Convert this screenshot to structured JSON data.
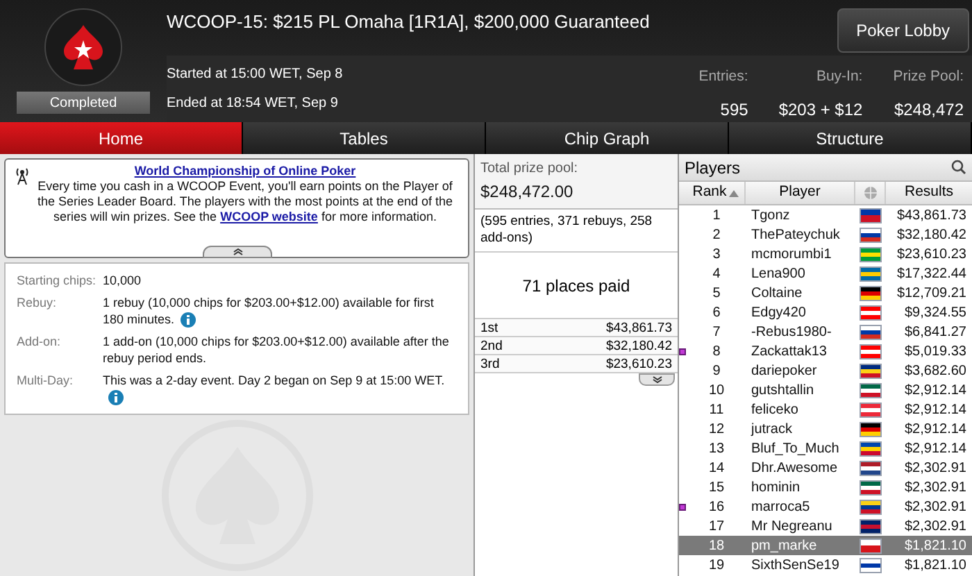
{
  "header": {
    "title": "WCOOP-15: $215 PL Omaha [1R1A], $200,000 Guaranteed",
    "status": "Completed",
    "started": "Started at 15:00 WET, Sep 8",
    "ended": "Ended at 18:54 WET, Sep 9",
    "lobby_button": "Poker Lobby",
    "stats": [
      {
        "label": "Entries:",
        "value": "595"
      },
      {
        "label": "Buy-In:",
        "value": "$203 + $12"
      },
      {
        "label": "Prize Pool:",
        "value": "$248,472"
      }
    ]
  },
  "tabs": [
    {
      "label": "Home",
      "selected": true
    },
    {
      "label": "Tables",
      "selected": false
    },
    {
      "label": "Chip Graph",
      "selected": false
    },
    {
      "label": "Structure",
      "selected": false
    }
  ],
  "notice": {
    "title": "World Championship of Online Poker",
    "text_before": "Every time you cash in a WCOOP Event, you'll earn points on the Player of the Series Leader Board. The players with the most points at the end of the series will win prizes. See the",
    "link": "WCOOP website",
    "text_after": "for more information."
  },
  "details": [
    {
      "label": "Starting chips:",
      "value": "10,000",
      "info": false
    },
    {
      "label": "Rebuy:",
      "value": "1 rebuy (10,000 chips for $203.00+$12.00) available for first 180 minutes.",
      "info": true
    },
    {
      "label": "Add-on:",
      "value": "1 add-on (10,000 chips for $203.00+$12.00) available after the rebuy period ends.",
      "info": false
    },
    {
      "label": "Multi-Day:",
      "value": "This was a 2-day event. Day 2 began on Sep 9 at 15:00 WET.",
      "info": true
    }
  ],
  "prizes": {
    "total_label": "Total prize pool:",
    "total": "$248,472.00",
    "breakdown": "(595 entries, 371 rebuys, 258 add-ons)",
    "places_paid": "71 places paid",
    "places": [
      {
        "place": "1st",
        "amount": "$43,861.73"
      },
      {
        "place": "2nd",
        "amount": "$32,180.42"
      },
      {
        "place": "3rd",
        "amount": "$23,610.23"
      }
    ]
  },
  "players": {
    "title": "Players",
    "columns": [
      "Rank",
      "Player",
      "Results"
    ],
    "rows": [
      {
        "rank": "1",
        "name": "Tgonz",
        "result": "$43,861.73",
        "flag_stripes": [
          {
            "color": "#0038a8"
          },
          {
            "color": "#ce1126"
          }
        ],
        "marked": false,
        "selected": false
      },
      {
        "rank": "2",
        "name": "ThePateychuk",
        "result": "$32,180.42",
        "flag_stripes": [
          {
            "color": "#ffffff"
          },
          {
            "color": "#0039a6"
          },
          {
            "color": "#d52b1e"
          }
        ],
        "marked": false,
        "selected": false
      },
      {
        "rank": "3",
        "name": "mcmorumbi1",
        "result": "$23,610.23",
        "flag_stripes": [
          {
            "color": "#009c3b"
          },
          {
            "color": "#ffdf00"
          },
          {
            "color": "#009c3b"
          }
        ],
        "marked": false,
        "selected": false
      },
      {
        "rank": "4",
        "name": "Lena900",
        "result": "$17,322.44",
        "flag_stripes": [
          {
            "color": "#006aa7"
          },
          {
            "color": "#fecc00"
          },
          {
            "color": "#006aa7"
          }
        ],
        "marked": false,
        "selected": false
      },
      {
        "rank": "5",
        "name": "Coltaine",
        "result": "$12,709.21",
        "flag_stripes": [
          {
            "color": "#000000"
          },
          {
            "color": "#dd0000"
          },
          {
            "color": "#ffce00"
          }
        ],
        "marked": false,
        "selected": false
      },
      {
        "rank": "6",
        "name": "Edgy420",
        "result": "$9,324.55",
        "flag_stripes": [
          {
            "color": "#ff0000"
          },
          {
            "color": "#ffffff"
          },
          {
            "color": "#ff0000"
          }
        ],
        "marked": false,
        "selected": false
      },
      {
        "rank": "7",
        "name": "-Rebus1980-",
        "result": "$6,841.27",
        "flag_stripes": [
          {
            "color": "#ffffff"
          },
          {
            "color": "#0039a6"
          },
          {
            "color": "#d52b1e"
          }
        ],
        "marked": false,
        "selected": false
      },
      {
        "rank": "8",
        "name": "Zackattak13",
        "result": "$5,019.33",
        "flag_stripes": [
          {
            "color": "#ff0000"
          },
          {
            "color": "#ffffff"
          },
          {
            "color": "#ff0000"
          }
        ],
        "marked": true,
        "selected": false
      },
      {
        "rank": "9",
        "name": "dariepoker",
        "result": "$3,682.60",
        "flag_stripes": [
          {
            "color": "#002b7f"
          },
          {
            "color": "#fcd116"
          },
          {
            "color": "#ce1126"
          }
        ],
        "marked": false,
        "selected": false
      },
      {
        "rank": "10",
        "name": "gutshtallin",
        "result": "$2,912.14",
        "flag_stripes": [
          {
            "color": "#006847"
          },
          {
            "color": "#ffffff"
          },
          {
            "color": "#ce1126"
          }
        ],
        "marked": false,
        "selected": false
      },
      {
        "rank": "11",
        "name": "feliceko",
        "result": "$2,912.14",
        "flag_stripes": [
          {
            "color": "#ed2939"
          },
          {
            "color": "#ffffff"
          },
          {
            "color": "#ed2939"
          }
        ],
        "marked": false,
        "selected": false
      },
      {
        "rank": "12",
        "name": "jutrack",
        "result": "$2,912.14",
        "flag_stripes": [
          {
            "color": "#000000"
          },
          {
            "color": "#dd0000"
          },
          {
            "color": "#ffce00"
          }
        ],
        "marked": false,
        "selected": false
      },
      {
        "rank": "13",
        "name": "Bluf_To_Much",
        "result": "$2,912.14",
        "flag_stripes": [
          {
            "color": "#0046ae"
          },
          {
            "color": "#ffd200"
          },
          {
            "color": "#cc092f"
          }
        ],
        "marked": false,
        "selected": false
      },
      {
        "rank": "14",
        "name": "Dhr.Awesome",
        "result": "$2,302.91",
        "flag_stripes": [
          {
            "color": "#ae1c28"
          },
          {
            "color": "#ffffff"
          },
          {
            "color": "#21468b"
          }
        ],
        "marked": false,
        "selected": false
      },
      {
        "rank": "15",
        "name": "hominin",
        "result": "$2,302.91",
        "flag_stripes": [
          {
            "color": "#006847"
          },
          {
            "color": "#ffffff"
          },
          {
            "color": "#ce1126"
          }
        ],
        "marked": false,
        "selected": false
      },
      {
        "rank": "16",
        "name": "marroca5",
        "result": "$2,302.91",
        "flag_stripes": [
          {
            "color": "#fcd116"
          },
          {
            "color": "#003893"
          },
          {
            "color": "#ce1126"
          }
        ],
        "marked": true,
        "selected": false
      },
      {
        "rank": "17",
        "name": "Mr Negreanu",
        "result": "$2,302.91",
        "flag_stripes": [
          {
            "color": "#012169"
          },
          {
            "color": "#c8102e"
          },
          {
            "color": "#012169"
          }
        ],
        "marked": false,
        "selected": false
      },
      {
        "rank": "18",
        "name": "pm_marke",
        "result": "$1,821.10",
        "flag_stripes": [
          {
            "color": "#ffffff"
          },
          {
            "color": "#d7141a"
          }
        ],
        "marked": false,
        "selected": true
      },
      {
        "rank": "19",
        "name": "SixthSenSe19",
        "result": "$1,821.10",
        "flag_stripes": [
          {
            "color": "#ffffff"
          },
          {
            "color": "#0038a8"
          },
          {
            "color": "#ffffff"
          }
        ],
        "marked": false,
        "selected": false
      }
    ]
  }
}
